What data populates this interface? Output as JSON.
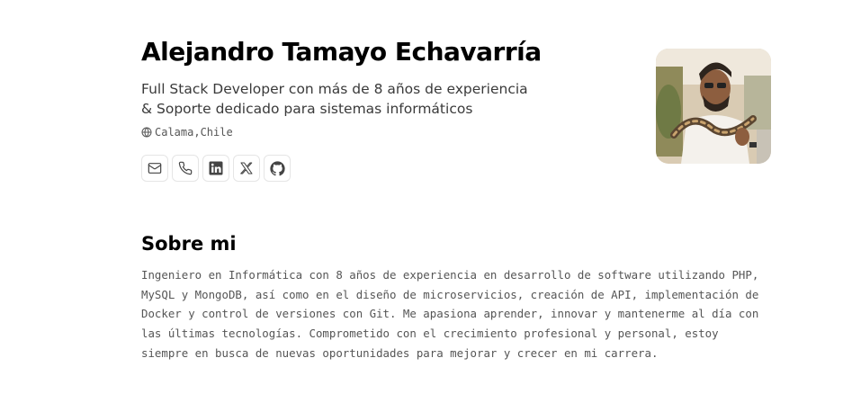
{
  "profile": {
    "name": "Alejandro Tamayo Echavarría",
    "subtitle": "Full Stack Developer con más de 8 años de experiencia & Soporte dedicado para sistemas informáticos",
    "location": "Calama,Chile",
    "location_icon": "globe-icon",
    "avatar_alt": "Foto de perfil"
  },
  "socials": [
    {
      "name": "email",
      "icon": "mail-icon"
    },
    {
      "name": "phone",
      "icon": "phone-icon"
    },
    {
      "name": "linkedin",
      "icon": "linkedin-icon"
    },
    {
      "name": "x",
      "icon": "x-icon"
    },
    {
      "name": "github",
      "icon": "github-icon"
    }
  ],
  "about": {
    "title": "Sobre mi",
    "text": "Ingeniero en Informática con 8 años de experiencia en desarrollo de software utilizando PHP, MySQL y MongoDB, así como en el diseño de microservicios, creación de API, implementación de Docker y control de versiones con Git. Me apasiona aprender, innovar y mantenerme al día con las últimas tecnologías. Comprometido con el crecimiento profesional y personal, estoy siempre en busca de nuevas oportunidades para mejorar y crecer en mi carrera."
  },
  "colors": {
    "text_primary": "#000000",
    "text_secondary": "#3a3a3a",
    "text_muted": "#555555",
    "border": "#e5e5e5"
  }
}
